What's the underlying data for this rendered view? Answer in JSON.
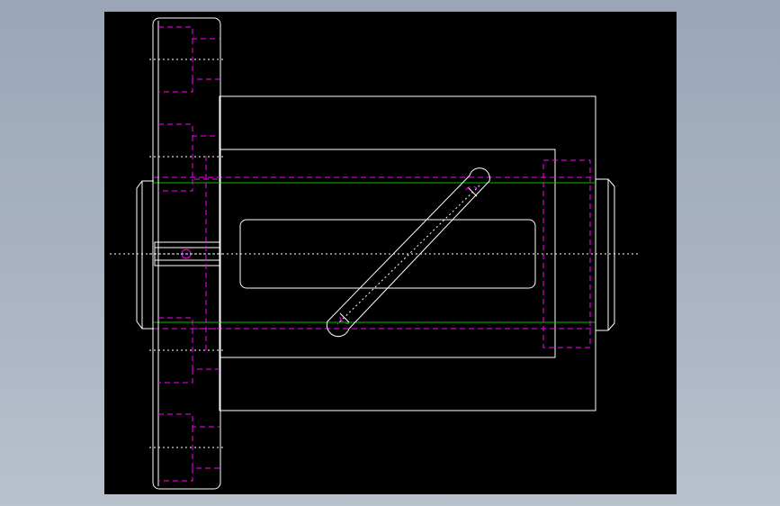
{
  "colors": {
    "canvas_background": "#000000",
    "outline": "#ffffff",
    "hidden_lines": "#ff00ff",
    "reference_lines": "#00c000",
    "window_background": "#a9b3c2"
  },
  "drawing": {
    "style": "CAD orthographic view",
    "parts": [
      "gear-disk",
      "outer-housing",
      "inner-body",
      "shaft",
      "slot",
      "diagonal-link"
    ]
  }
}
